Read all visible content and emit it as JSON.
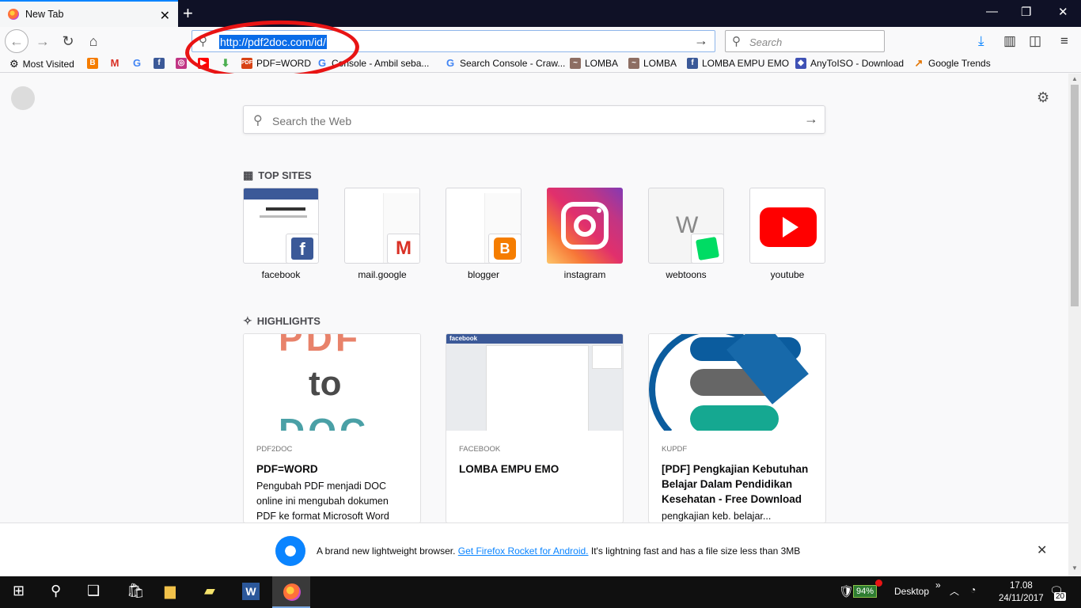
{
  "tab": {
    "title": "New Tab",
    "close": "✕"
  },
  "window": {
    "new_tab": "+",
    "minimize": "—",
    "restore": "❐",
    "close": "✕"
  },
  "nav": {
    "url": "http://pdf2doc.com/id/",
    "search_placeholder": "Search"
  },
  "bookmarks": [
    {
      "label": "Most Visited",
      "icon": "gear-icon",
      "color": "#444444"
    },
    {
      "label": "",
      "icon": "blogger-icon",
      "color": "#f57d00"
    },
    {
      "label": "",
      "icon": "gmail-icon",
      "color": "#d93025"
    },
    {
      "label": "",
      "icon": "google-icon",
      "color": "#4285f4"
    },
    {
      "label": "",
      "icon": "facebook-icon",
      "color": "#3b5998"
    },
    {
      "label": "",
      "icon": "instagram-icon",
      "color": "#c13584"
    },
    {
      "label": "",
      "icon": "youtube-icon",
      "color": "#ff0000"
    },
    {
      "label": "",
      "icon": "download-icon",
      "color": "#4caf50"
    },
    {
      "label": "PDF=WORD",
      "icon": "pdf-icon",
      "color": "#d84315"
    },
    {
      "label": "Console - Ambil seba...",
      "icon": "google-icon",
      "color": "#4285f4"
    },
    {
      "label": "Search Console - Craw...",
      "icon": "google-icon",
      "color": "#4285f4"
    },
    {
      "label": "LOMBA",
      "icon": "lomba-icon",
      "color": "#8d6e63"
    },
    {
      "label": "LOMBA",
      "icon": "lomba-icon",
      "color": "#8d6e63"
    },
    {
      "label": "LOMBA EMPU EMO",
      "icon": "facebook-icon",
      "color": "#3b5998"
    },
    {
      "label": "AnyToISO - Download",
      "icon": "anytoiso-icon",
      "color": "#3f51b5"
    },
    {
      "label": "Google Trends",
      "icon": "trends-icon",
      "color": "#e37400"
    }
  ],
  "newtab": {
    "search_placeholder": "Search the Web",
    "top_sites_title": "TOP SITES",
    "highlights_title": "HIGHLIGHTS",
    "top_sites": [
      {
        "label": "facebook",
        "badge": "facebook-icon"
      },
      {
        "label": "mail.google",
        "badge": "gmail-icon"
      },
      {
        "label": "blogger",
        "badge": "blogger-icon"
      },
      {
        "label": "instagram",
        "badge": "instagram-icon"
      },
      {
        "label": "webtoons",
        "badge": "webtoons-icon",
        "letter": "W"
      },
      {
        "label": "youtube",
        "badge": "youtube-icon"
      }
    ],
    "highlights": [
      {
        "source": "PDF2DOC",
        "title": "PDF=WORD",
        "desc": "Pengubah PDF menjadi DOC online ini mengubah dokumen PDF ke format Microsoft Word DOC",
        "img_text": [
          "PDF",
          "to",
          "DOC"
        ]
      },
      {
        "source": "FACEBOOK",
        "title": "LOMBA EMPU EMO",
        "desc": "",
        "img_text": [
          "facebook"
        ]
      },
      {
        "source": "KUPDF",
        "title": "[PDF] Pengkajian Kebutuhan Belajar Dalam Pendidikan Kesehatan - Free Download",
        "desc": "pengkajian keb. belajar...",
        "img_text": []
      }
    ]
  },
  "notification": {
    "text_before": "A brand new lightweight browser. ",
    "link": "Get Firefox Rocket for Android.",
    "text_after": " It's lightning fast and has a file size less than 3MB",
    "close": "✕"
  },
  "taskbar": {
    "battery": "94%",
    "desktop": "Desktop",
    "time": "17.08",
    "date": "24/11/2017",
    "notifications": "20"
  },
  "colors": {
    "accent": "#0a84ff",
    "annotation": "#e81414",
    "taskbar": "#101010"
  }
}
